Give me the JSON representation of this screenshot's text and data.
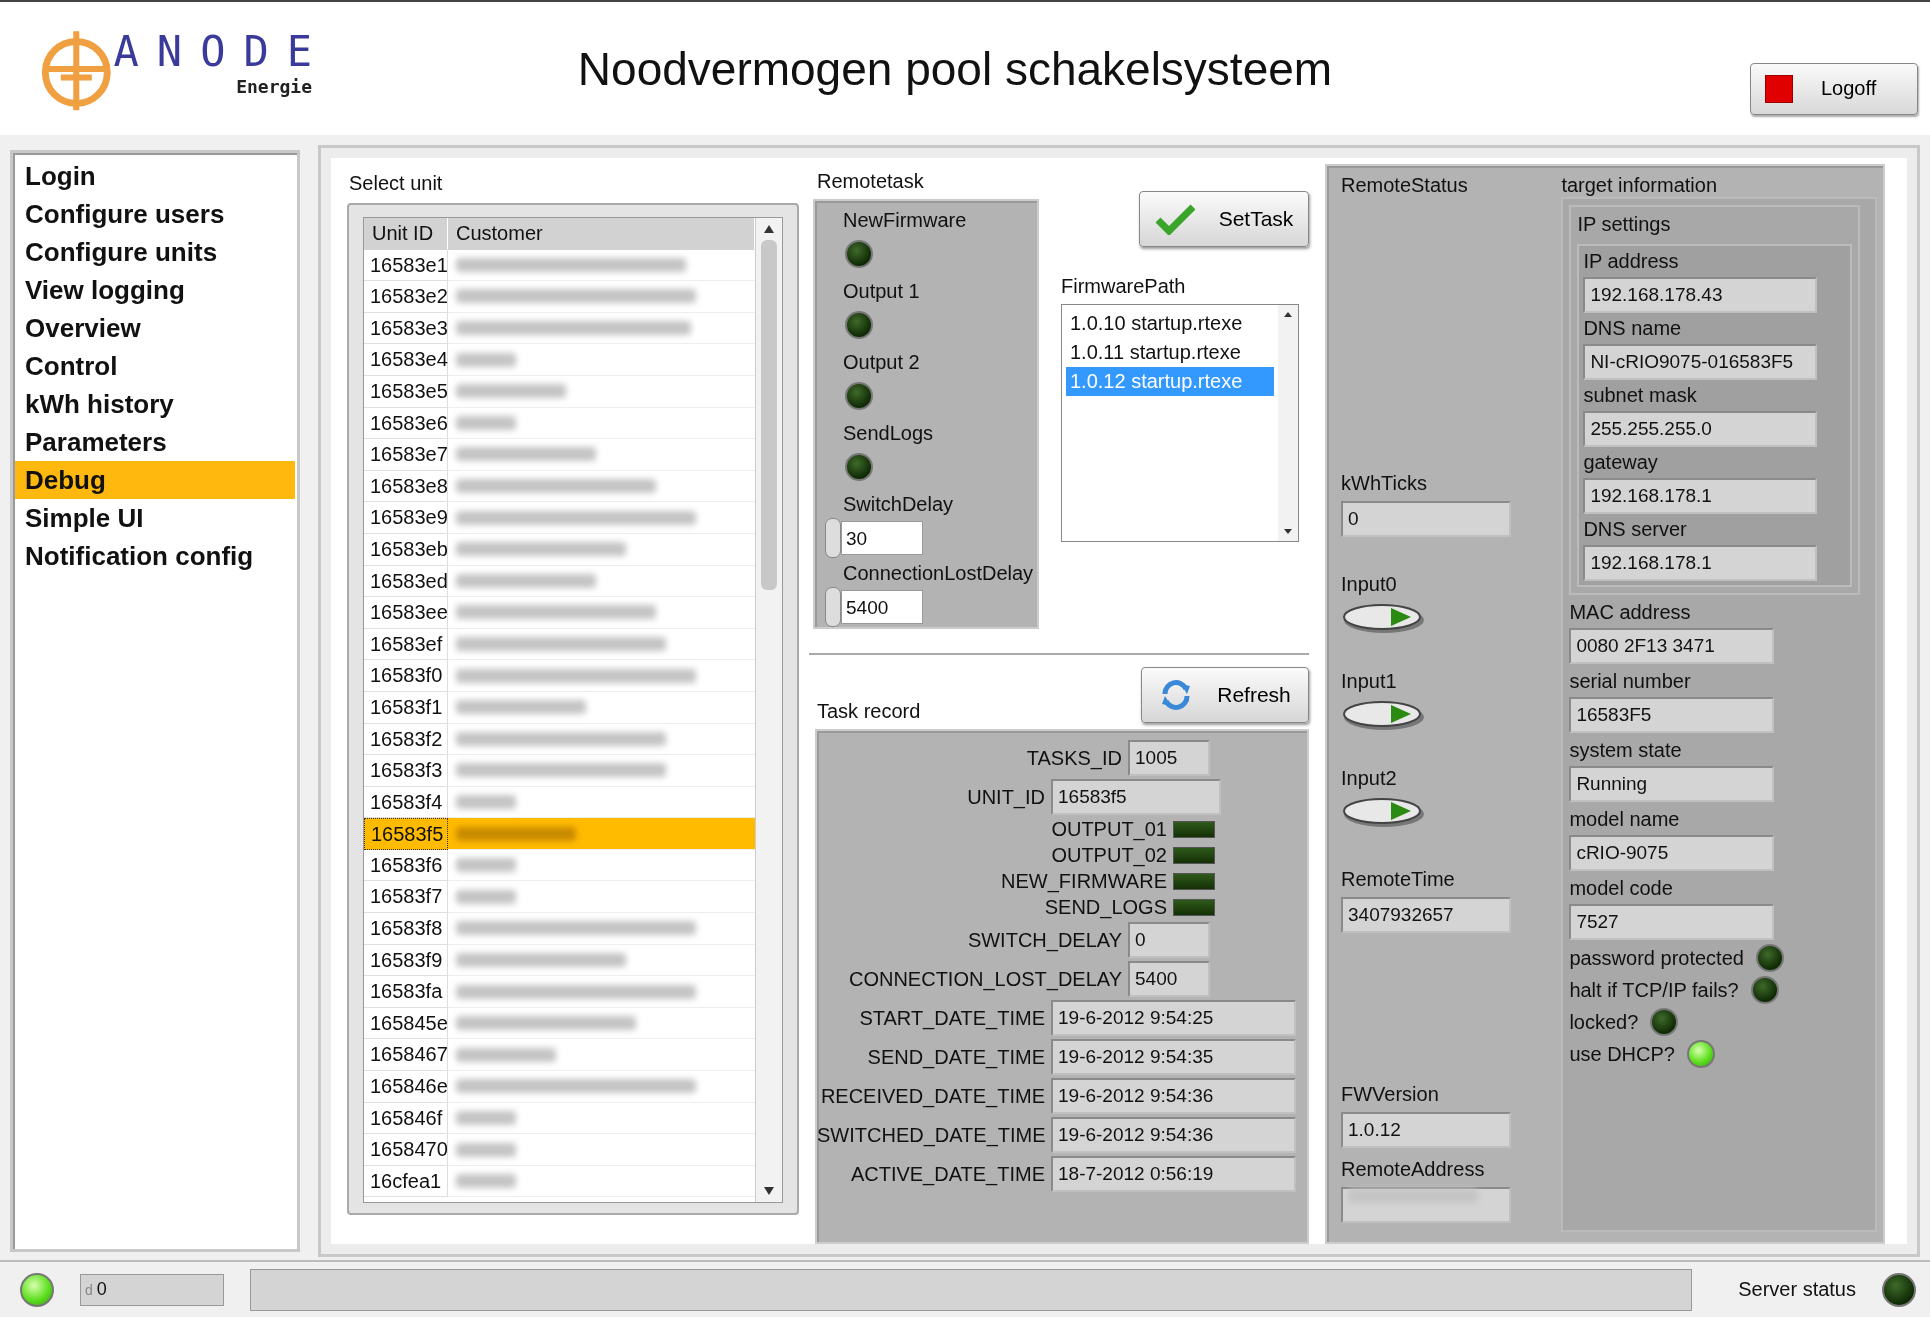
{
  "header": {
    "logo_text": "ANODE",
    "logo_subtext": "Energie",
    "title": "Noodvermogen pool schakelsysteem",
    "logoff_button": "Logoff"
  },
  "nav": {
    "items": [
      {
        "label": "Login",
        "selected": false
      },
      {
        "label": "Configure users",
        "selected": false
      },
      {
        "label": "Configure units",
        "selected": false
      },
      {
        "label": "View logging",
        "selected": false
      },
      {
        "label": "Overview",
        "selected": false
      },
      {
        "label": "Control",
        "selected": false
      },
      {
        "label": "kWh history",
        "selected": false
      },
      {
        "label": "Parameters",
        "selected": false
      },
      {
        "label": "Debug",
        "selected": true
      },
      {
        "label": "Simple UI",
        "selected": false
      },
      {
        "label": "Notification config",
        "selected": false
      }
    ]
  },
  "select_unit": {
    "title": "Select unit",
    "columns": [
      "Unit ID",
      "Customer"
    ],
    "rows": [
      {
        "unit_id": "16583e1",
        "selected": false
      },
      {
        "unit_id": "16583e2",
        "selected": false
      },
      {
        "unit_id": "16583e3",
        "selected": false
      },
      {
        "unit_id": "16583e4",
        "selected": false
      },
      {
        "unit_id": "16583e5",
        "selected": false
      },
      {
        "unit_id": "16583e6",
        "selected": false
      },
      {
        "unit_id": "16583e7",
        "selected": false
      },
      {
        "unit_id": "16583e8",
        "selected": false
      },
      {
        "unit_id": "16583e9",
        "selected": false
      },
      {
        "unit_id": "16583eb",
        "selected": false
      },
      {
        "unit_id": "16583ed",
        "selected": false
      },
      {
        "unit_id": "16583ee",
        "selected": false
      },
      {
        "unit_id": "16583ef",
        "selected": false
      },
      {
        "unit_id": "16583f0",
        "selected": false
      },
      {
        "unit_id": "16583f1",
        "selected": false
      },
      {
        "unit_id": "16583f2",
        "selected": false
      },
      {
        "unit_id": "16583f3",
        "selected": false
      },
      {
        "unit_id": "16583f4",
        "selected": false
      },
      {
        "unit_id": "16583f5",
        "selected": true
      },
      {
        "unit_id": "16583f6",
        "selected": false
      },
      {
        "unit_id": "16583f7",
        "selected": false
      },
      {
        "unit_id": "16583f8",
        "selected": false
      },
      {
        "unit_id": "16583f9",
        "selected": false
      },
      {
        "unit_id": "16583fa",
        "selected": false
      },
      {
        "unit_id": "165845e",
        "selected": false
      },
      {
        "unit_id": "1658467",
        "selected": false
      },
      {
        "unit_id": "165846e",
        "selected": false
      },
      {
        "unit_id": "165846f",
        "selected": false
      },
      {
        "unit_id": "1658470",
        "selected": false
      },
      {
        "unit_id": "16cfea1",
        "selected": false
      }
    ]
  },
  "remotetask": {
    "title": "Remotetask",
    "items": [
      {
        "kind": "led",
        "label": "NewFirmware",
        "on": false
      },
      {
        "kind": "led",
        "label": "Output 1",
        "on": false
      },
      {
        "kind": "led",
        "label": "Output 2",
        "on": false
      },
      {
        "kind": "led",
        "label": "SendLogs",
        "on": false
      },
      {
        "kind": "number",
        "label": "SwitchDelay",
        "value": "30"
      },
      {
        "kind": "number",
        "label": "ConnectionLostDelay",
        "value": "5400"
      }
    ],
    "settask_button": "SetTask",
    "firmware_path": {
      "label": "FirmwarePath",
      "items": [
        {
          "label": "1.0.10 startup.rtexe",
          "selected": false
        },
        {
          "label": "1.0.11 startup.rtexe",
          "selected": false
        },
        {
          "label": "1.0.12 startup.rtexe",
          "selected": true
        }
      ]
    }
  },
  "task_record": {
    "title": "Task record",
    "refresh_button": "Refresh",
    "fields": [
      {
        "kind": "number",
        "label": "TASKS_ID",
        "value": "1005"
      },
      {
        "kind": "text",
        "label": "UNIT_ID",
        "value": "16583f5"
      },
      {
        "kind": "led",
        "label": "OUTPUT_01",
        "on": false
      },
      {
        "kind": "led",
        "label": "OUTPUT_02",
        "on": false
      },
      {
        "kind": "led",
        "label": "NEW_FIRMWARE",
        "on": false
      },
      {
        "kind": "led",
        "label": "SEND_LOGS",
        "on": false
      },
      {
        "kind": "number",
        "label": "SWITCH_DELAY",
        "value": "0"
      },
      {
        "kind": "number",
        "label": "CONNECTION_LOST_DELAY",
        "value": "5400"
      },
      {
        "kind": "date",
        "label": "START_DATE_TIME",
        "value": "19-6-2012 9:54:25"
      },
      {
        "kind": "date",
        "label": "SEND_DATE_TIME",
        "value": "19-6-2012 9:54:35"
      },
      {
        "kind": "date",
        "label": "RECEIVED_DATE_TIME",
        "value": "19-6-2012 9:54:36"
      },
      {
        "kind": "date",
        "label": "SWITCHED_DATE_TIME",
        "value": "19-6-2012 9:54:36"
      },
      {
        "kind": "date",
        "label": "ACTIVE_DATE_TIME",
        "value": "18-7-2012 0:56:19"
      }
    ]
  },
  "remote_status": {
    "title": "RemoteStatus",
    "items": [
      {
        "kind": "field",
        "label": "kWhTicks",
        "value": "0"
      },
      {
        "kind": "toggle",
        "label": "Input0",
        "on": true
      },
      {
        "kind": "toggle",
        "label": "Input1",
        "on": true
      },
      {
        "kind": "toggle",
        "label": "Input2",
        "on": true
      },
      {
        "kind": "field",
        "label": "RemoteTime",
        "value": "3407932657"
      },
      {
        "kind": "field",
        "label": "FWVersion",
        "value": "1.0.12"
      },
      {
        "kind": "hidden",
        "label": "RemoteAddress"
      }
    ]
  },
  "target_information": {
    "title": "target information",
    "ip_settings": {
      "title": "IP settings",
      "fields": [
        {
          "label": "IP address",
          "value": "192.168.178.43"
        },
        {
          "label": "DNS name",
          "value": "NI-cRIO9075-016583F5"
        },
        {
          "label": "subnet mask",
          "value": "255.255.255.0"
        },
        {
          "label": "gateway",
          "value": "192.168.178.1"
        },
        {
          "label": "DNS server",
          "value": "192.168.178.1"
        }
      ]
    },
    "items": [
      {
        "kind": "field",
        "label": "MAC address",
        "value": "0080 2F13 3471"
      },
      {
        "kind": "field",
        "label": "serial number",
        "value": "16583F5"
      },
      {
        "kind": "field",
        "label": "system state",
        "value": "Running"
      },
      {
        "kind": "field",
        "label": "model name",
        "value": "cRIO-9075"
      },
      {
        "kind": "field",
        "label": "model code",
        "value": "7527"
      },
      {
        "kind": "led",
        "label": "password protected",
        "on": false
      },
      {
        "kind": "led",
        "label": "halt if TCP/IP fails?",
        "on": false
      },
      {
        "kind": "led",
        "label": "locked?",
        "on": false
      },
      {
        "kind": "led",
        "label": "use DHCP?",
        "on": true
      }
    ]
  },
  "status_bar": {
    "led_on": true,
    "radix": "d",
    "value": "0",
    "server_label": "Server status",
    "server_on": false
  }
}
